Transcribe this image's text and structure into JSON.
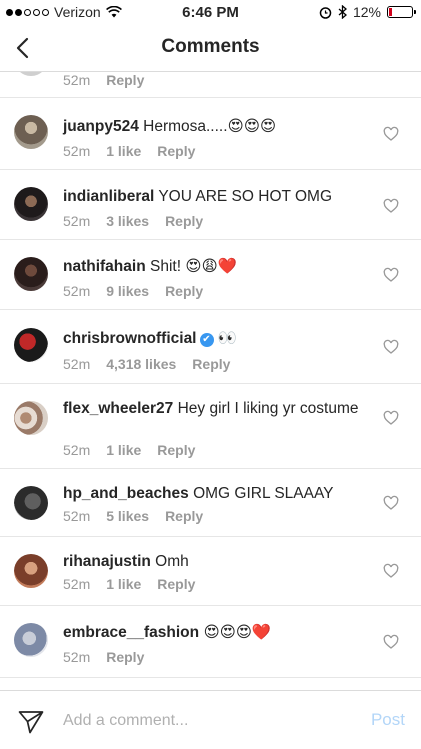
{
  "status_bar": {
    "carrier": "Verizon",
    "time": "6:46 PM",
    "battery": "12%",
    "battery_level": 0.12
  },
  "nav": {
    "title": "Comments",
    "back_icon": "chevron-left-icon"
  },
  "partial_comment": {
    "time": "52m",
    "reply": "Reply"
  },
  "comments": [
    {
      "username": "juanpy524",
      "text": "Hermosa.....😍😍😍",
      "time": "52m",
      "likes": "1 like",
      "reply": "Reply"
    },
    {
      "username": "indianliberal",
      "text": "YOU ARE SO HOT OMG",
      "time": "52m",
      "likes": "3 likes",
      "reply": "Reply"
    },
    {
      "username": "nathifahain",
      "text": "Shit! 😍😩❤️",
      "time": "52m",
      "likes": "9 likes",
      "reply": "Reply"
    },
    {
      "username": "chrisbrownofficial",
      "verified": "✔",
      "text": "👀",
      "time": "52m",
      "likes": "4,318 likes",
      "reply": "Reply"
    },
    {
      "username": "flex_wheeler27",
      "text": "Hey girl I liking yr costume",
      "time": "52m",
      "likes": "1 like",
      "reply": "Reply"
    },
    {
      "username": "hp_and_beaches",
      "text": "OMG GIRL SLAAAY",
      "time": "52m",
      "likes": "5 likes",
      "reply": "Reply"
    },
    {
      "username": "rihanajustin",
      "text": "Omh",
      "time": "52m",
      "likes": "1 like",
      "reply": "Reply"
    },
    {
      "username": "embrace__fashion",
      "text": "😍😍😍❤️",
      "time": "52m",
      "reply": "Reply"
    }
  ],
  "composer": {
    "placeholder": "Add a comment...",
    "post_label": "Post"
  }
}
